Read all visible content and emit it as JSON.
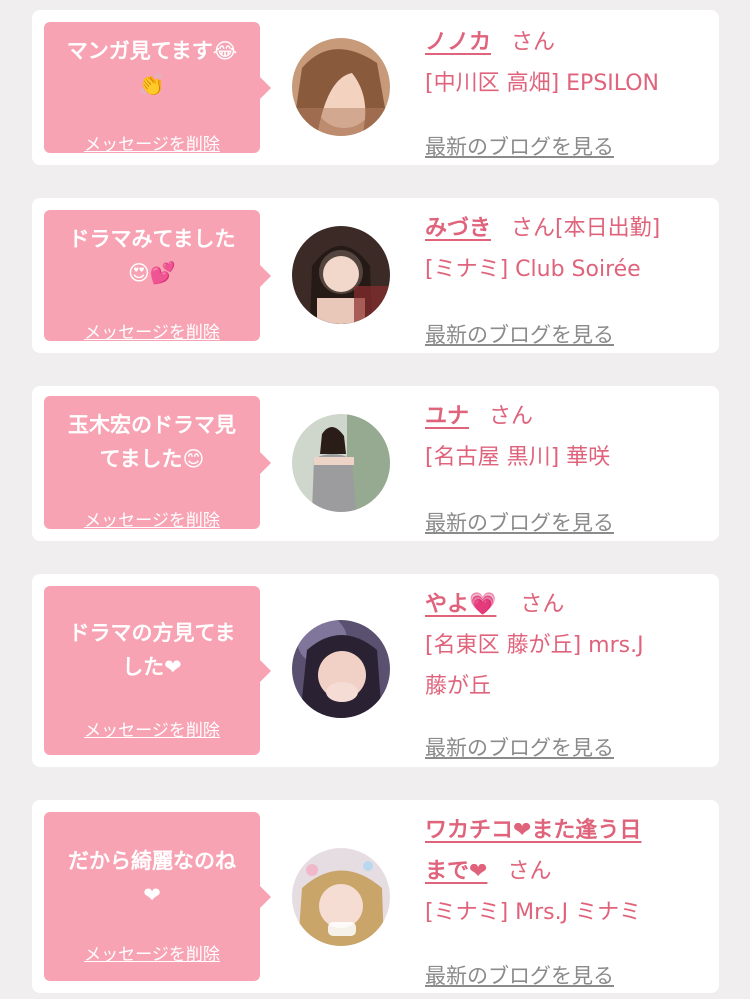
{
  "cards": [
    {
      "message": "マンガ見てます😂👏",
      "message_l1": "マンガ見てます😂",
      "message_l2": "👏",
      "delete_label": "メッセージを削除",
      "name": "ノノカ",
      "honorific": "さん",
      "status": "",
      "shop": "[中川区 高畑] EPSILON",
      "blog_link": "最新のブログを見る"
    },
    {
      "message": "ドラマみてました😍💕",
      "message_l1": "ドラマみてました",
      "message_l2": "😍💕",
      "delete_label": "メッセージを削除",
      "name": "みづき",
      "honorific": "さん",
      "status": "[本日出勤]",
      "shop": "[ミナミ] Club Soirée",
      "blog_link": "最新のブログを見る"
    },
    {
      "message": "玉木宏のドラマ見てました😊",
      "message_l1": "玉木宏のドラマ見",
      "message_l2": "てました😊",
      "delete_label": "メッセージを削除",
      "name": "ユナ",
      "honorific": "さん",
      "status": "",
      "shop": "[名古屋 黒川] 華咲",
      "blog_link": "最新のブログを見る"
    },
    {
      "message": "ドラマの方見てました❤️",
      "message_l1": "ドラマの方見てま",
      "message_l2": "した❤",
      "delete_label": "メッセージを削除",
      "name": "やよ💗",
      "honorific": "さん",
      "status": "",
      "shop_l1": "[名東区 藤が丘] mrs.J",
      "shop_l2": "藤が丘",
      "blog_link": "最新のブログを見る"
    },
    {
      "message": "だから綺麗なのね❤️",
      "message_l1": "だから綺麗なのね",
      "message_l2": "❤",
      "delete_label": "メッセージを削除",
      "name_l1": "ワカチコ❤また逢う日",
      "name_l2": "まで❤",
      "honorific": "さん",
      "status": "",
      "shop": "[ミナミ] Mrs.J ミナミ",
      "blog_link": "最新のブログを見る"
    }
  ],
  "colors": {
    "bubble": "#f7a3b3",
    "accent": "#e0637c",
    "background": "#f0eeef"
  }
}
